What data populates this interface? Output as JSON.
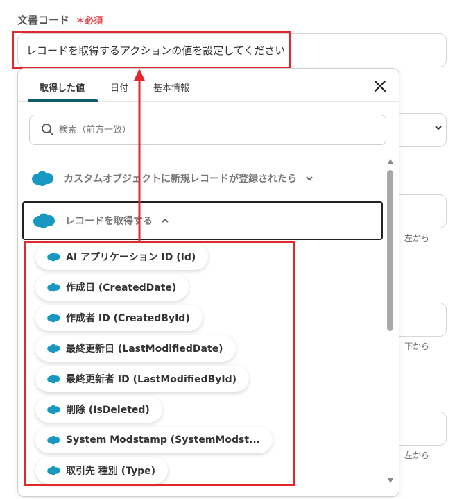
{
  "field": {
    "label": "文書コード",
    "required_mark": "＊",
    "required_text": "必須",
    "value": "レコードを取得するアクションの値を設定してください"
  },
  "background": {
    "hints": [
      "、左から",
      "、下から",
      "、左から"
    ]
  },
  "popup": {
    "tabs": [
      {
        "label": "取得した値"
      },
      {
        "label": "日付"
      },
      {
        "label": "基本情報"
      }
    ],
    "search_placeholder": "検索（前方一致）",
    "sections": [
      {
        "label": "カスタムオブジェクトに新規レコードが登録されたら"
      },
      {
        "label": "レコードを取得する"
      }
    ],
    "items": [
      {
        "label": "AI アプリケーション ID (Id)"
      },
      {
        "label": "作成日 (CreatedDate)"
      },
      {
        "label": "作成者 ID (CreatedById)"
      },
      {
        "label": "最終更新日 (LastModifiedDate)"
      },
      {
        "label": "最終更新者 ID (LastModifiedById)"
      },
      {
        "label": "削除 (IsDeleted)"
      },
      {
        "label": "System Modstamp (SystemModst..."
      },
      {
        "label": "取引先 種別 (Type)"
      }
    ]
  },
  "colors": {
    "accent": "#0d5b6b",
    "salesforce": "#1798c1",
    "highlight": "#e0282e",
    "required": "#e5484d"
  },
  "icons": {
    "close": "close-icon",
    "search": "search-icon",
    "logo": "salesforce-cloud-icon"
  }
}
